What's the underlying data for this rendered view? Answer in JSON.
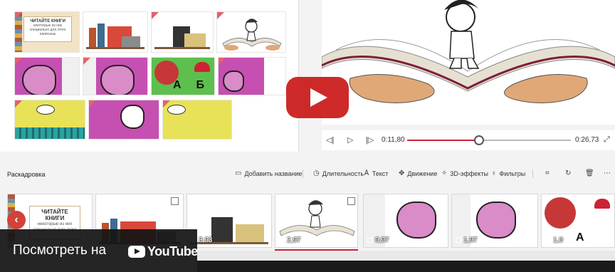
{
  "library": {
    "book_card_title": "ЧИТАЙТЕ КНИГИ",
    "book_card_text": "некоторые из них специально для этого написаны"
  },
  "player": {
    "current_time": "0:11,80",
    "total_time": "0:26,73",
    "progress": 0.44
  },
  "storyboard": {
    "title": "Раскадровка",
    "toolbar": {
      "add_title": "Добавить название",
      "duration": "Длительность",
      "text": "Текст",
      "motion": "Движение",
      "effects_3d": "3D-эффекты",
      "filters": "Фильтры"
    },
    "clips": [
      {
        "card_title": "ЧИТАЙТЕ КНИГИ",
        "card_text": "некоторые из них специально для этого",
        "duration": ""
      },
      {
        "duration": ""
      },
      {
        "duration": "3,93"
      },
      {
        "duration": "2,97"
      },
      {
        "duration": "0,97"
      },
      {
        "duration": "1,97"
      },
      {
        "duration": "1,0"
      }
    ]
  },
  "youtube": {
    "watch_on": "Посмотреть на",
    "brand": "YouTube"
  },
  "colors": {
    "accent": "#c8243b",
    "yt_red": "#cc1f1f"
  }
}
